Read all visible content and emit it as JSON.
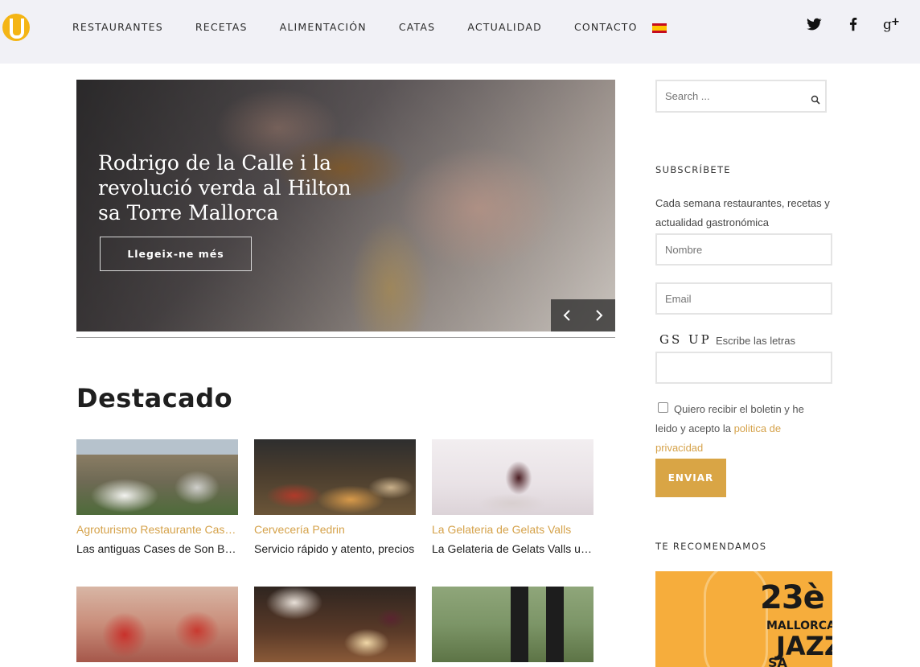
{
  "header": {
    "logo_icon": "yellow-circle-logo-icon",
    "nav": [
      "RESTAURANTES",
      "RECETAS",
      "ALIMENTACIÓN",
      "CATAS",
      "ACTUALIDAD",
      "CONTACTO"
    ],
    "language_flag": "spain-flag-icon",
    "social": [
      "twitter-icon",
      "facebook-icon",
      "google-plus-icon"
    ]
  },
  "hero": {
    "title": "Rodrigo de la Calle i la revolució verda al Hilton sa Torre Mallorca",
    "button_label": "Llegeix-ne més",
    "prev_icon": "chevron-left-icon",
    "next_icon": "chevron-right-icon"
  },
  "featured": {
    "heading": "Destacado",
    "cards": [
      {
        "title": "Agroturismo Restaurante Cases de Son Barbassa",
        "desc": "Las antiguas Cases de Son Barbassa"
      },
      {
        "title": "Cervecería Pedrin",
        "desc": "Servicio rápido y atento, precios"
      },
      {
        "title": "La Gelateria de Gelats Valls",
        "desc": "La Gelateria de Gelats Valls useless"
      },
      {
        "title": "",
        "desc": ""
      },
      {
        "title": "",
        "desc": ""
      },
      {
        "title": "",
        "desc": ""
      }
    ]
  },
  "sidebar": {
    "search_placeholder": "Search ...",
    "subscribe_heading": "SUBSCRÍBETE",
    "subscribe_text": "Cada semana restaurantes, recetas y actualidad gastronómica",
    "name_placeholder": "Nombre",
    "email_placeholder": "Email",
    "captcha": "GS UP",
    "captcha_label": "Escribe las letras",
    "consent_text": "Quiero recibir el boletin y he leido y acepto la ",
    "consent_link": "politica de privacidad",
    "submit_label": "ENVIAR",
    "recommend_heading": "TE RECOMENDAMOS",
    "ad": {
      "number": "23è",
      "line1": "MALLORCA",
      "line2": "JAZZ",
      "line3": "SA POBLA"
    }
  },
  "colors": {
    "accent": "#d9a545",
    "link": "#d5a24a",
    "header_bg": "#f1f1f6"
  }
}
